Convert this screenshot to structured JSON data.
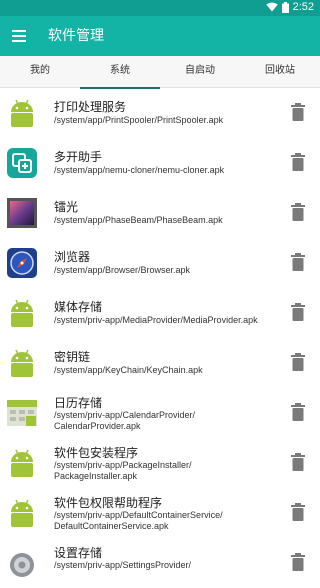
{
  "status_bar": {
    "time": "2:52",
    "wifi_icon": "wifi-icon",
    "battery_icon": "battery-icon"
  },
  "app_bar": {
    "menu_icon": "hamburger-menu-icon",
    "title": "软件管理"
  },
  "tabs": [
    {
      "label": "我的"
    },
    {
      "label": "系统",
      "active": true
    },
    {
      "label": "自启动"
    },
    {
      "label": "回收站"
    }
  ],
  "apps": [
    {
      "name": "打印处理服务",
      "path": "/system/app/PrintSpooler/PrintSpooler.apk",
      "icon": "android-icon"
    },
    {
      "name": "多开助手",
      "path": "/system/app/nemu-cloner/nemu-cloner.apk",
      "icon": "multi-open-icon"
    },
    {
      "name": "镭光",
      "path": "/system/app/PhaseBeam/PhaseBeam.apk",
      "icon": "phasebeam-icon"
    },
    {
      "name": "浏览器",
      "path": "/system/app/Browser/Browser.apk",
      "icon": "browser-compass-icon"
    },
    {
      "name": "媒体存储",
      "path": "/system/priv-app/MediaProvider/MediaProvider.apk",
      "icon": "android-icon"
    },
    {
      "name": "密钥链",
      "path": "/system/app/KeyChain/KeyChain.apk",
      "icon": "android-icon"
    },
    {
      "name": "日历存储",
      "path_line1": "/system/priv-app/CalendarProvider/",
      "path_line2": "CalendarProvider.apk",
      "icon": "calendar-storage-icon"
    },
    {
      "name": "软件包安装程序",
      "path_line1": "/system/priv-app/PackageInstaller/",
      "path_line2": "PackageInstaller.apk",
      "icon": "android-icon"
    },
    {
      "name": "软件包权限帮助程序",
      "path_line1": "/system/priv-app/DefaultContainerService/",
      "path_line2": "DefaultContainerService.apk",
      "icon": "android-icon"
    },
    {
      "name": "设置存储",
      "path_line1": "/system/priv-app/SettingsProvider/",
      "icon": "settings-gear-icon"
    }
  ],
  "colors": {
    "status_bar": "#109e92",
    "app_bar": "#13b3a6",
    "tab_indicator": "#1f6f68",
    "trash": "#7a7a7a",
    "android_green": "#9fc437"
  }
}
